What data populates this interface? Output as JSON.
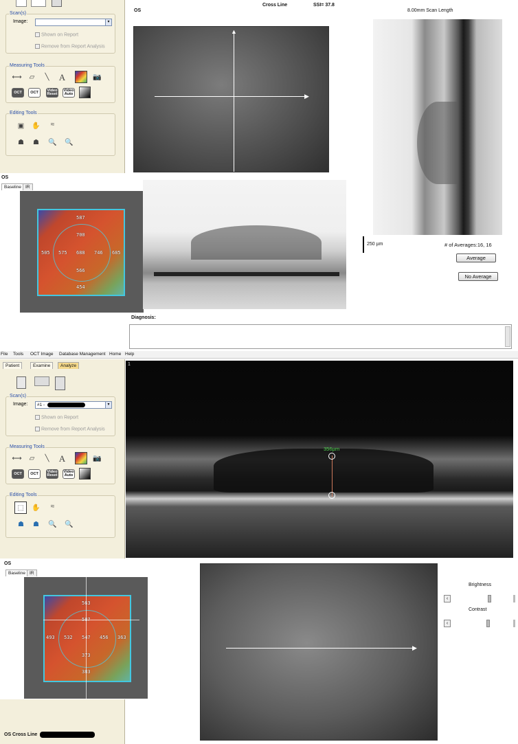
{
  "top": {
    "header": {
      "eye": "OS",
      "cross_line": "Cross Line",
      "ssi": "SSI= 37.8",
      "scan_length": "8.00mm Scan Length"
    },
    "scans": {
      "title": "Scan(s)",
      "image_label": "Image:",
      "image_value": "",
      "shown_on_report": "Shown on Report",
      "remove_from_report": "Remove from Report Analysis"
    },
    "measuring_tools": {
      "title": "Measuring Tools"
    },
    "editing_tools": {
      "title": "Editing Tools"
    },
    "bottom_eye": "OS",
    "tabs": [
      "Baseline",
      "IR"
    ],
    "thickness_values": [
      "587",
      "700",
      "505",
      "575",
      "688",
      "746",
      "685",
      "566",
      "454"
    ],
    "scale_bar": "250 µm",
    "averages": "# of Averages:16, 16",
    "average_button": "Average",
    "no_average_button": "No Average",
    "diagnosis_label": "Diagnosis:"
  },
  "bottom": {
    "menu": [
      "File",
      "Tools",
      "OCT Image",
      "Database Management",
      "Home",
      "Help"
    ],
    "tabs": [
      "Patient",
      "Examine",
      "Analyze"
    ],
    "scans": {
      "title": "Scan(s)",
      "image_label": "Image:",
      "image_value": "#1 -",
      "shown_on_report": "Shown on Report",
      "remove_from_report": "Remove from Report Analysis"
    },
    "measuring_tools": {
      "title": "Measuring Tools"
    },
    "editing_tools": {
      "title": "Editing Tools"
    },
    "oct_index": "1",
    "measurement": "356µm",
    "eye": "OS",
    "fundus_tabs": [
      "Baseline",
      "IR"
    ],
    "thickness_values": [
      "563",
      "587",
      "493",
      "532",
      "547",
      "456",
      "363",
      "373",
      "383"
    ],
    "brightness_label": "Brightness",
    "contrast_label": "Contrast",
    "footer_label": "OS Cross Line"
  }
}
